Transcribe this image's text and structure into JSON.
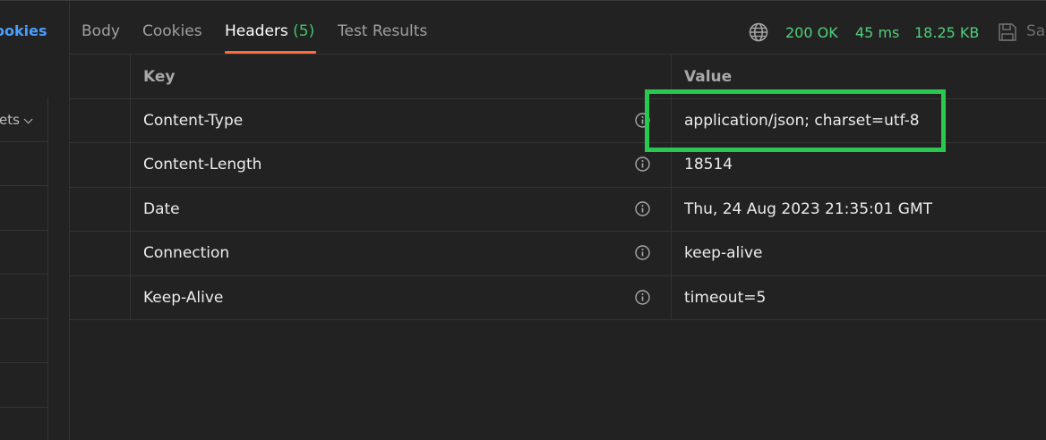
{
  "left": {
    "cookies_label": "ookies",
    "sets_label": "ets"
  },
  "tabs": [
    {
      "label": "Body"
    },
    {
      "label": "Cookies"
    },
    {
      "label": "Headers",
      "count": "(5)"
    },
    {
      "label": "Test Results"
    }
  ],
  "response": {
    "status": "200 OK",
    "time": "45 ms",
    "size": "18.25 KB",
    "save_label": "Sa"
  },
  "table": {
    "key_header": "Key",
    "value_header": "Value",
    "rows": [
      {
        "key": "Content-Type",
        "value": "application/json; charset=utf-8"
      },
      {
        "key": "Content-Length",
        "value": "18514"
      },
      {
        "key": "Date",
        "value": "Thu, 24 Aug 2023 21:35:01 GMT"
      },
      {
        "key": "Connection",
        "value": "keep-alive"
      },
      {
        "key": "Keep-Alive",
        "value": "timeout=5"
      }
    ]
  },
  "colors": {
    "accent_tab": "#ff6b3c",
    "status_green": "#4fd07a",
    "highlight_green": "#2bc84f",
    "link_blue": "#4a9eff"
  }
}
